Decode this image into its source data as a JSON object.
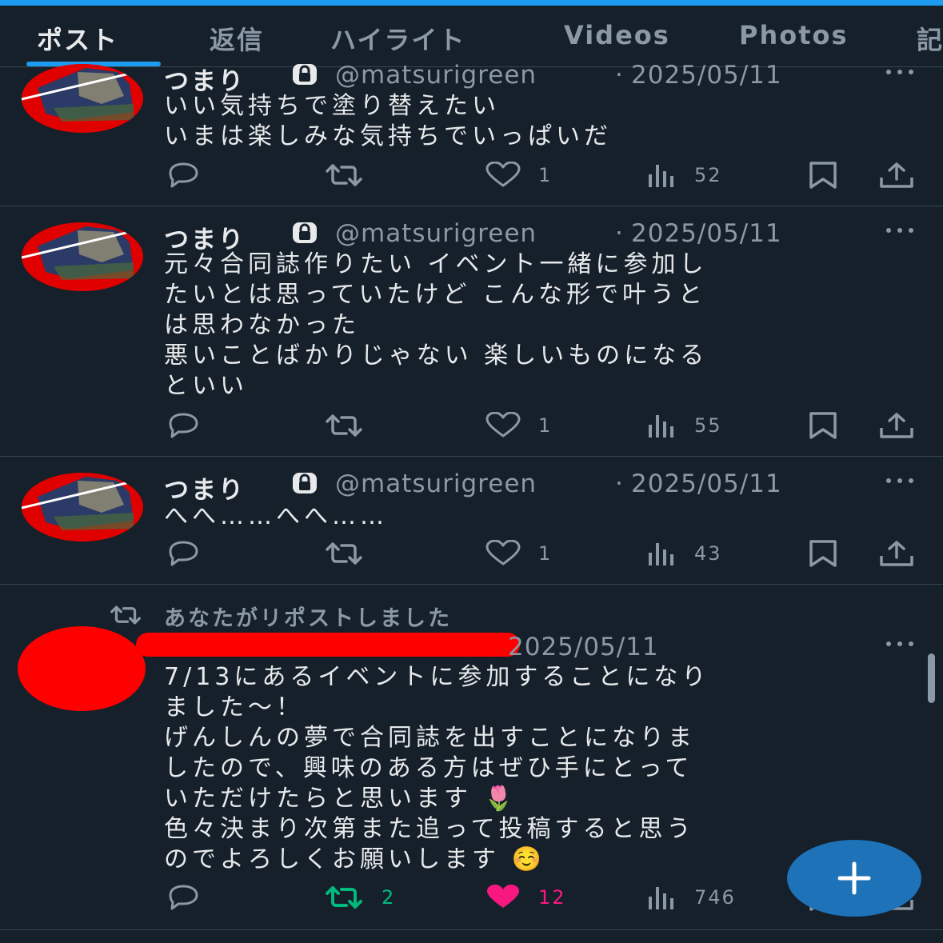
{
  "tabs": [
    "ポスト",
    "返信",
    "ハイライト",
    "Videos",
    "Photos",
    "記"
  ],
  "active_tab": "ポスト",
  "posts": [
    {
      "name": "つまり",
      "handle": "@matsurigreen",
      "separator": "·",
      "date": "2025/05/11",
      "lines": [
        "いい気持ちで塗り替えたい",
        "いまは楽しみな気持ちでいっぱいだ"
      ],
      "likes": "1",
      "views": "52"
    },
    {
      "name": "つまり",
      "handle": "@matsurigreen",
      "separator": "·",
      "date": "2025/05/11",
      "lines": [
        "元々合同誌作りたい イベント一緒に参加し",
        "たいとは思っていたけど こんな形で叶うと",
        "は思わなかった",
        "悪いことばかりじゃない 楽しいものになる",
        "といい"
      ],
      "likes": "1",
      "views": "55"
    },
    {
      "name": "つまり",
      "handle": "@matsurigreen",
      "separator": "·",
      "date": "2025/05/11",
      "lines": [
        "へへ……へへ……"
      ],
      "likes": "1",
      "views": "43"
    },
    {
      "repost_label": "あなたがリポストしました",
      "date": "2025/05/11",
      "lines": [
        "7/13にあるイベントに参加することになり",
        "ました〜！",
        "げんしんの夢で合同誌を出すことになりま",
        "したので、興味のある方はぜひ手にとって",
        "いただけたらと思います 🌷",
        "色々決まり次第また追って投稿すると思う",
        "のでよろしくお願いします ☺️"
      ],
      "reposts": "2",
      "likes": "12",
      "views": "746"
    }
  ],
  "icons": {
    "reply": "reply-icon",
    "repost": "repost-icon",
    "like": "heart-icon",
    "views": "views-icon",
    "bookmark": "bookmark-icon",
    "share": "share-icon",
    "lock": "lock-icon",
    "more": "more-icon",
    "fab": "plus-icon"
  },
  "colors": {
    "background": "#15202b",
    "accent": "#1d9bf0",
    "text": "#e7e9ea",
    "muted": "#8b98a5",
    "repost_active": "#00ba7c",
    "like_active": "#f91880",
    "divider": "#38444d",
    "fab": "#1d72b8",
    "redaction": "#ff0000"
  }
}
